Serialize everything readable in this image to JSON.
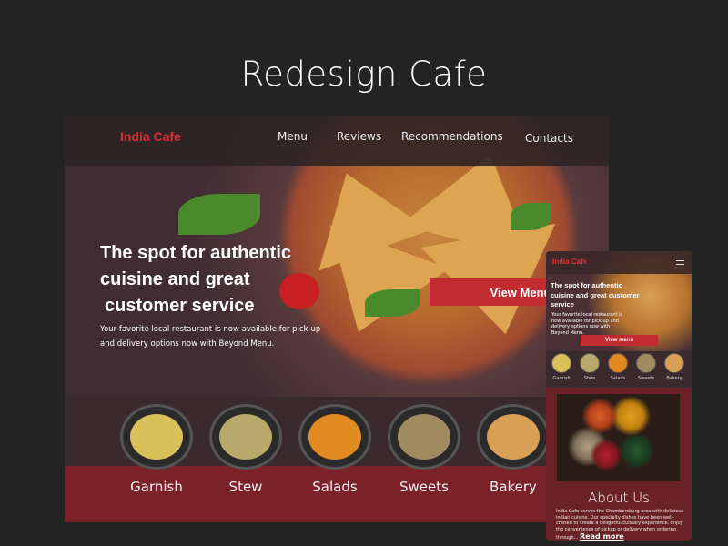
{
  "page_title": "Redesign Cafe",
  "desktop": {
    "brand": "India Cafe",
    "nav": [
      "Menu",
      "Reviews",
      "Recommendations",
      "Contacts"
    ],
    "headline": [
      "The spot for authentic",
      "cuisine and great",
      "customer service"
    ],
    "subtitle": "Your favorite local restaurant is now available for pick-up and delivery options now with Beyond Menu.",
    "cta": "View Menu",
    "categories": [
      {
        "label": "Garnish",
        "color": "#d9c05a"
      },
      {
        "label": "Stew",
        "color": "#b8a86a"
      },
      {
        "label": "Salads",
        "color": "#e08a20"
      },
      {
        "label": "Sweets",
        "color": "#a08a60"
      },
      {
        "label": "Bakery",
        "color": "#d9a055"
      }
    ]
  },
  "mobile": {
    "brand": "India Cafe",
    "menu_icon": "hamburger-icon",
    "headline": "The spot for authentic cuisine and great customer service",
    "subtitle": "Your favorite local restaurant is now available for pick-up and delivery options now with Beyond Menu.",
    "cta": "View menu",
    "categories": [
      "Garnish",
      "Stew",
      "Salads",
      "Sweets",
      "Bakery"
    ],
    "about_title": "About Us",
    "about_text": "India Cafe serves the Chambersburg  area with delicious indian cuisine.  Our specialty dishes have been  well-crafted to create a delightful culinary experience. Enjoy the convenience of pickup or delivery when ordering through... ",
    "read_more": "Read more"
  },
  "colors": {
    "accent": "#c22c30",
    "brand": "#d63030",
    "band": "#7a2228"
  }
}
